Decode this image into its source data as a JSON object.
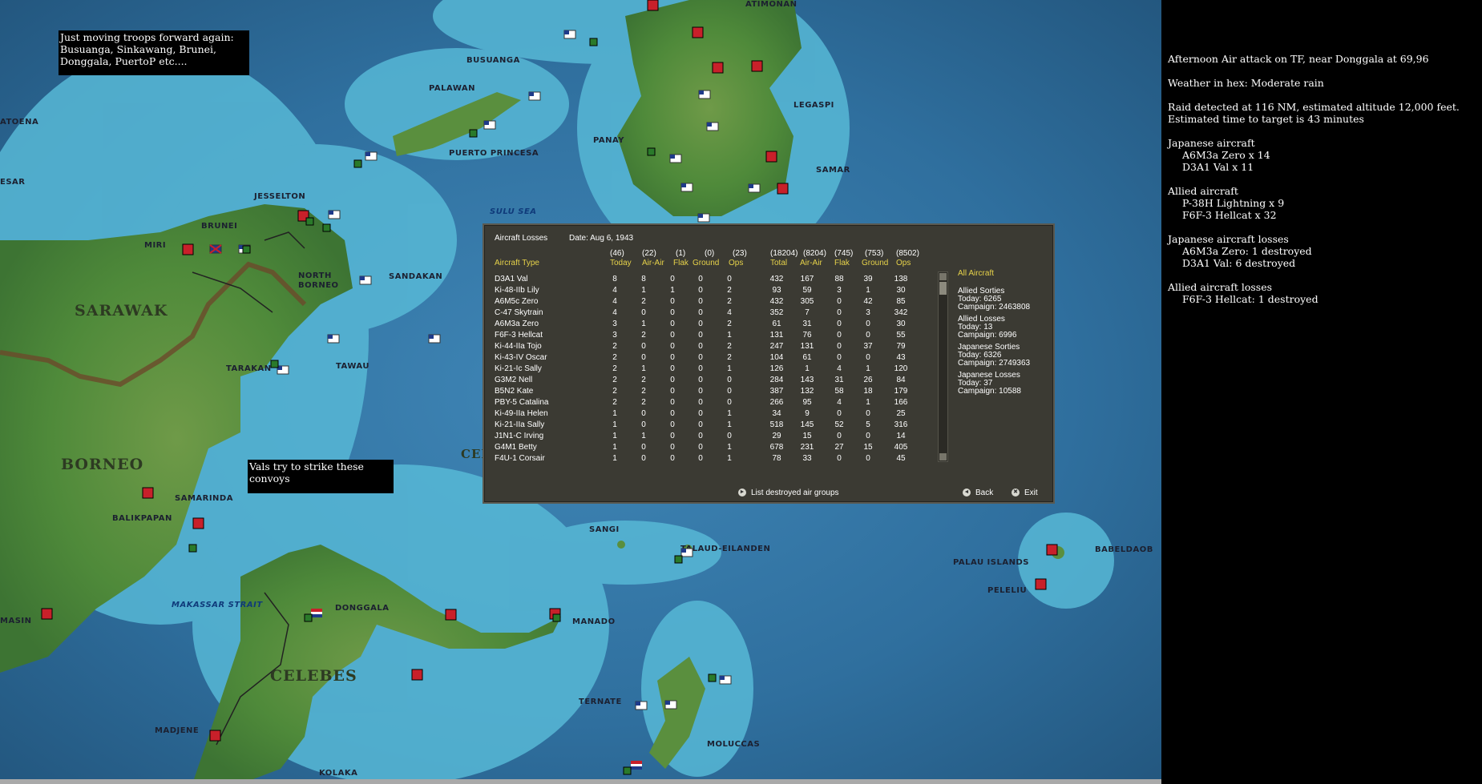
{
  "map": {
    "labels": {
      "busuanga": "BUSUANGA",
      "palawan": "PALAWAN",
      "puerto_princesa": "PUERTO PRINCESA",
      "panay": "PANAY",
      "samar": "SAMAR",
      "legaspi": "LEGASPI",
      "atimonan": "ATIMONAN",
      "sulu_sea": "SULU SEA",
      "jesselton": "JESSELTON",
      "brunei": "BRUNEI",
      "miri": "MIRI",
      "north_borneo": "NORTH\nBORNEO",
      "sandakan": "SANDAKAN",
      "sarawak": "SARAWAK",
      "tarakan": "TARAKAN",
      "tawau": "TAWAU",
      "borneo": "BORNEO",
      "samarinda": "SAMARINDA",
      "balikpapan": "BALIKPAPAN",
      "makassar_strait": "MAKASSAR STRAIT",
      "masin": "MASIN",
      "donggala": "DONGGALA",
      "celebes": "CELEBES",
      "madjene": "MADJENE",
      "kolaka": "KOLAKA",
      "sangi": "SANGI",
      "talaud": "TALAUD-EILANDEN",
      "manado": "MANADO",
      "ternate": "TERNATE",
      "moluccas": "MOLUCCAS",
      "palau": "PALAU ISLANDS",
      "peleliu": "PELELIU",
      "babeldaob": "BABELDAOB",
      "atoena": "ATOENA",
      "esar": "ESAR",
      "cel": "CEL"
    },
    "notes": {
      "troops": "Just moving troops forward again:\nBusuanga, Sinkawang, Brunei,\nDonggala, PuertoP etc....",
      "vals": "Vals try to strike these convoys"
    }
  },
  "report": {
    "lines": [
      {
        "text": "Afternoon Air attack on TF, near Donggala at 69,96",
        "indent": false
      },
      {
        "text": "Weather in hex: Moderate rain",
        "indent": false
      },
      {
        "text": "Raid detected at 116 NM, estimated altitude 12,000 feet.",
        "indent": false
      },
      {
        "text": "Estimated time to target is 43 minutes",
        "indent": false
      },
      {
        "text": "Japanese aircraft",
        "indent": false
      },
      {
        "text": "A6M3a Zero x 14",
        "indent": true
      },
      {
        "text": "D3A1 Val x 11",
        "indent": true
      },
      {
        "text": "Allied aircraft",
        "indent": false
      },
      {
        "text": "P-38H Lightning x 9",
        "indent": true
      },
      {
        "text": "F6F-3 Hellcat x 32",
        "indent": true
      },
      {
        "text": "Japanese aircraft losses",
        "indent": false
      },
      {
        "text": "A6M3a Zero: 1 destroyed",
        "indent": true
      },
      {
        "text": "D3A1 Val: 6 destroyed",
        "indent": true
      },
      {
        "text": "Allied aircraft losses",
        "indent": false
      },
      {
        "text": "F6F-3 Hellcat: 1 destroyed",
        "indent": true
      }
    ]
  },
  "dialog": {
    "title": "Aircraft Losses",
    "date": "Date: Aug 6, 1943",
    "totals": [
      "(46)",
      "(22)",
      "(1)",
      "(0)",
      "(23)",
      "(18204)",
      "(8204)",
      "(745)",
      "(753)",
      "(8502)"
    ],
    "columns": [
      "Aircraft Type",
      "Today",
      "Air-Air",
      "Flak",
      "Ground",
      "Ops",
      "Total",
      "Air-Air",
      "Flak",
      "Ground",
      "Ops"
    ],
    "rows": [
      [
        "D3A1 Val",
        "8",
        "8",
        "0",
        "0",
        "0",
        "432",
        "167",
        "88",
        "39",
        "138"
      ],
      [
        "Ki-48-IIb Lily",
        "4",
        "1",
        "1",
        "0",
        "2",
        "93",
        "59",
        "3",
        "1",
        "30"
      ],
      [
        "A6M5c Zero",
        "4",
        "2",
        "0",
        "0",
        "2",
        "432",
        "305",
        "0",
        "42",
        "85"
      ],
      [
        "C-47 Skytrain",
        "4",
        "0",
        "0",
        "0",
        "4",
        "352",
        "7",
        "0",
        "3",
        "342"
      ],
      [
        "A6M3a Zero",
        "3",
        "1",
        "0",
        "0",
        "2",
        "61",
        "31",
        "0",
        "0",
        "30"
      ],
      [
        "F6F-3 Hellcat",
        "3",
        "2",
        "0",
        "0",
        "1",
        "131",
        "76",
        "0",
        "0",
        "55"
      ],
      [
        "Ki-44-IIa Tojo",
        "2",
        "0",
        "0",
        "0",
        "2",
        "247",
        "131",
        "0",
        "37",
        "79"
      ],
      [
        "Ki-43-IV Oscar",
        "2",
        "0",
        "0",
        "0",
        "2",
        "104",
        "61",
        "0",
        "0",
        "43"
      ],
      [
        "Ki-21-Ic Sally",
        "2",
        "1",
        "0",
        "0",
        "1",
        "126",
        "1",
        "4",
        "1",
        "120"
      ],
      [
        "G3M2 Nell",
        "2",
        "2",
        "0",
        "0",
        "0",
        "284",
        "143",
        "31",
        "26",
        "84"
      ],
      [
        "B5N2 Kate",
        "2",
        "2",
        "0",
        "0",
        "0",
        "387",
        "132",
        "58",
        "18",
        "179"
      ],
      [
        "PBY-5 Catalina",
        "2",
        "2",
        "0",
        "0",
        "0",
        "266",
        "95",
        "4",
        "1",
        "166"
      ],
      [
        "Ki-49-IIa Helen",
        "1",
        "0",
        "0",
        "0",
        "1",
        "34",
        "9",
        "0",
        "0",
        "25"
      ],
      [
        "Ki-21-IIa Sally",
        "1",
        "0",
        "0",
        "0",
        "1",
        "518",
        "145",
        "52",
        "5",
        "316"
      ],
      [
        "J1N1-C Irving",
        "1",
        "1",
        "0",
        "0",
        "0",
        "29",
        "15",
        "0",
        "0",
        "14"
      ],
      [
        "G4M1 Betty",
        "1",
        "0",
        "0",
        "0",
        "1",
        "678",
        "231",
        "27",
        "15",
        "405"
      ],
      [
        "F4U-1 Corsair",
        "1",
        "0",
        "0",
        "0",
        "1",
        "78",
        "33",
        "0",
        "0",
        "45"
      ]
    ],
    "side": {
      "all_aircraft": "All Aircraft",
      "allied_sorties": "Allied Sorties",
      "allied_sorties_today": "Today:  6265",
      "allied_sorties_campaign": "Campaign: 2463808",
      "allied_losses": "Allied Losses",
      "allied_losses_today": "Today:  13",
      "allied_losses_campaign": "Campaign: 6996",
      "japanese_sorties": "Japanese Sorties",
      "japanese_sorties_today": "Today:  6326",
      "japanese_sorties_campaign": "Campaign: 2749363",
      "japanese_losses": "Japanese Losses",
      "japanese_losses_today": "Today:  37",
      "japanese_losses_campaign": "Campaign: 10588"
    },
    "buttons": {
      "list_destroyed": "List destroyed air groups",
      "back": "Back",
      "exit": "Exit"
    }
  },
  "colors": {
    "sea_deep": "#23577f",
    "sea_shallow": "#57b8d6",
    "land": "#4f8a3a",
    "header_yellow": "#e6d24a",
    "dialog_bg": "#3b3a33"
  },
  "icons": [
    "flag-us-icon",
    "flag-japan-icon",
    "flag-uk-icon",
    "flag-netherlands-icon",
    "unit-base-icon",
    "scrollbar-arrow-icon",
    "button-arrow-icon"
  ]
}
